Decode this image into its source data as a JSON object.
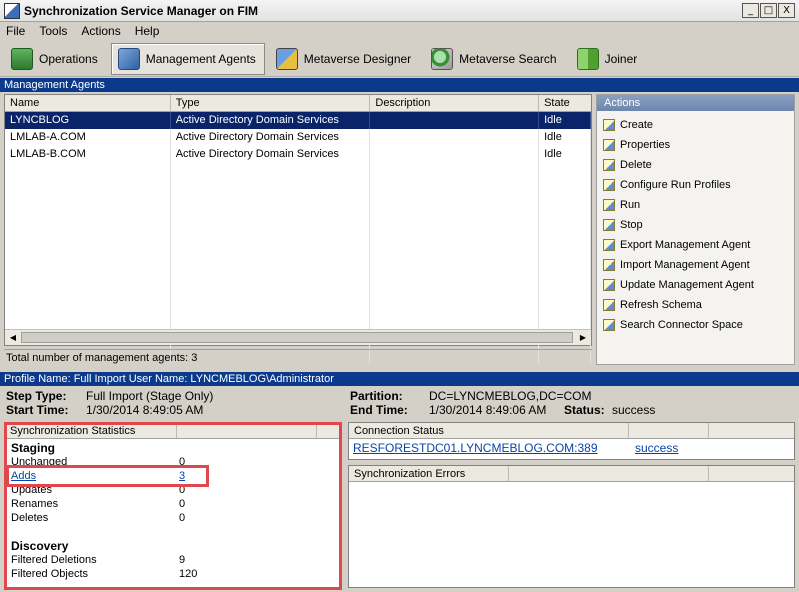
{
  "window": {
    "title": "Synchronization Service Manager on FIM",
    "min": "_",
    "max": "□",
    "close": "X"
  },
  "menu": [
    "File",
    "Tools",
    "Actions",
    "Help"
  ],
  "toolbar": {
    "operations": "Operations",
    "management_agents": "Management Agents",
    "metaverse_designer": "Metaverse Designer",
    "metaverse_search": "Metaverse Search",
    "joiner": "Joiner"
  },
  "ma_section": {
    "title": "Management Agents",
    "columns": [
      "Name",
      "Type",
      "Description",
      "State"
    ],
    "rows": [
      {
        "name": "LYNCBLOG",
        "type": "Active Directory Domain Services",
        "description": "",
        "state": "Idle"
      },
      {
        "name": "LMLAB-A.COM",
        "type": "Active Directory Domain Services",
        "description": "",
        "state": "Idle"
      },
      {
        "name": "LMLAB-B.COM",
        "type": "Active Directory Domain Services",
        "description": "",
        "state": "Idle"
      }
    ],
    "total": "Total number of management agents: 3"
  },
  "actions": {
    "title": "Actions",
    "items": [
      "Create",
      "Properties",
      "Delete",
      "Configure Run Profiles",
      "Run",
      "Stop",
      "Export Management Agent",
      "Import Management Agent",
      "Update Management Agent",
      "Refresh Schema",
      "Search Connector Space"
    ]
  },
  "profile_line": "Profile Name: Full Import  User Name: LYNCMEBLOG\\Administrator",
  "run_info": {
    "step_type_label": "Step Type:",
    "step_type": "Full Import (Stage Only)",
    "start_time_label": "Start Time:",
    "start_time": "1/30/2014 8:49:05 AM",
    "partition_label": "Partition:",
    "partition": "DC=LYNCMEBLOG,DC=COM",
    "end_time_label": "End Time:",
    "end_time": "1/30/2014 8:49:06 AM",
    "status_label": "Status:",
    "status": "success"
  },
  "sync_stats": {
    "header": "Synchronization Statistics",
    "staging_title": "Staging",
    "staging": [
      {
        "name": "Unchanged",
        "value": "0"
      },
      {
        "name": "Adds",
        "value": "3"
      },
      {
        "name": "Updates",
        "value": "0"
      },
      {
        "name": "Renames",
        "value": "0"
      },
      {
        "name": "Deletes",
        "value": "0"
      }
    ],
    "discovery_title": "Discovery",
    "discovery": [
      {
        "name": "Filtered Deletions",
        "value": "9"
      },
      {
        "name": "Filtered Objects",
        "value": "120"
      }
    ]
  },
  "connection_status": {
    "header": "Connection Status",
    "server": "RESFORESTDC01.LYNCMEBLOG.COM:389",
    "result": "success"
  },
  "sync_errors": {
    "header": "Synchronization Errors"
  },
  "colors": {
    "selection": "#0a246a",
    "section_header": "#0b3a8c",
    "highlight": "#e0484e",
    "link": "#0645ad"
  }
}
